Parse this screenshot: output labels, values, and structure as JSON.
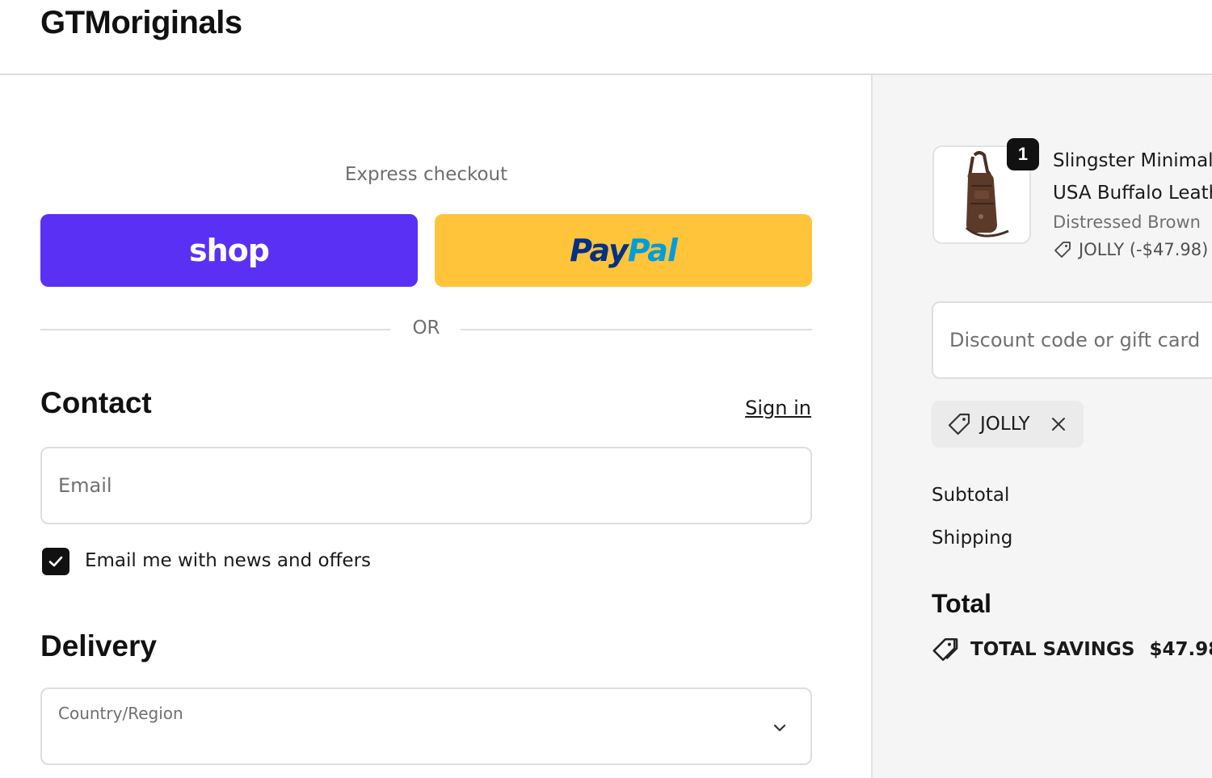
{
  "header": {
    "brand": "GTMoriginals"
  },
  "express": {
    "label": "Express checkout",
    "shop_label": "shop",
    "paypal_part1": "Pay",
    "paypal_part2": "Pal",
    "or_label": "OR"
  },
  "contact": {
    "title": "Contact",
    "sign_in": "Sign in",
    "email_placeholder": "Email",
    "newsletter_label": "Email me with news and offers",
    "newsletter_checked": true
  },
  "delivery": {
    "title": "Delivery",
    "country_label": "Country/Region"
  },
  "summary": {
    "item": {
      "quantity": "1",
      "name_line1": "Slingster Minimal",
      "name_line2": "USA Buffalo Leath",
      "variant": "Distressed Brown",
      "discount": "JOLLY (-$47.98)"
    },
    "discount_placeholder": "Discount code or gift card",
    "applied_code": "JOLLY",
    "subtotal_label": "Subtotal",
    "shipping_label": "Shipping",
    "total_label": "Total",
    "savings_label": "TOTAL SAVINGS",
    "savings_amount": "$47.98"
  },
  "colors": {
    "shop_purple": "#5a31f4",
    "paypal_yellow": "#ffc439",
    "paypal_dark_blue": "#003087",
    "paypal_light_blue": "#009cde"
  },
  "icons": [
    "checkmark-icon",
    "chevron-down-icon",
    "tag-icon",
    "close-icon",
    "savings-tag-icon",
    "product-bag-image"
  ]
}
